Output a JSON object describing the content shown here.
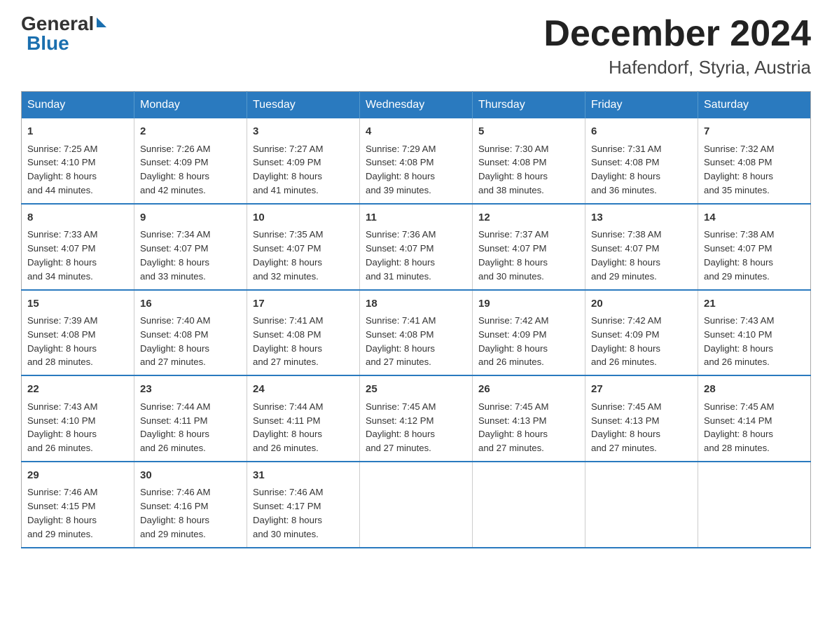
{
  "logo": {
    "general": "General",
    "blue": "Blue"
  },
  "title": "December 2024",
  "location": "Hafendorf, Styria, Austria",
  "days_of_week": [
    "Sunday",
    "Monday",
    "Tuesday",
    "Wednesday",
    "Thursday",
    "Friday",
    "Saturday"
  ],
  "weeks": [
    [
      {
        "day": "1",
        "sunrise": "7:25 AM",
        "sunset": "4:10 PM",
        "daylight": "8 hours and 44 minutes."
      },
      {
        "day": "2",
        "sunrise": "7:26 AM",
        "sunset": "4:09 PM",
        "daylight": "8 hours and 42 minutes."
      },
      {
        "day": "3",
        "sunrise": "7:27 AM",
        "sunset": "4:09 PM",
        "daylight": "8 hours and 41 minutes."
      },
      {
        "day": "4",
        "sunrise": "7:29 AM",
        "sunset": "4:08 PM",
        "daylight": "8 hours and 39 minutes."
      },
      {
        "day": "5",
        "sunrise": "7:30 AM",
        "sunset": "4:08 PM",
        "daylight": "8 hours and 38 minutes."
      },
      {
        "day": "6",
        "sunrise": "7:31 AM",
        "sunset": "4:08 PM",
        "daylight": "8 hours and 36 minutes."
      },
      {
        "day": "7",
        "sunrise": "7:32 AM",
        "sunset": "4:08 PM",
        "daylight": "8 hours and 35 minutes."
      }
    ],
    [
      {
        "day": "8",
        "sunrise": "7:33 AM",
        "sunset": "4:07 PM",
        "daylight": "8 hours and 34 minutes."
      },
      {
        "day": "9",
        "sunrise": "7:34 AM",
        "sunset": "4:07 PM",
        "daylight": "8 hours and 33 minutes."
      },
      {
        "day": "10",
        "sunrise": "7:35 AM",
        "sunset": "4:07 PM",
        "daylight": "8 hours and 32 minutes."
      },
      {
        "day": "11",
        "sunrise": "7:36 AM",
        "sunset": "4:07 PM",
        "daylight": "8 hours and 31 minutes."
      },
      {
        "day": "12",
        "sunrise": "7:37 AM",
        "sunset": "4:07 PM",
        "daylight": "8 hours and 30 minutes."
      },
      {
        "day": "13",
        "sunrise": "7:38 AM",
        "sunset": "4:07 PM",
        "daylight": "8 hours and 29 minutes."
      },
      {
        "day": "14",
        "sunrise": "7:38 AM",
        "sunset": "4:07 PM",
        "daylight": "8 hours and 29 minutes."
      }
    ],
    [
      {
        "day": "15",
        "sunrise": "7:39 AM",
        "sunset": "4:08 PM",
        "daylight": "8 hours and 28 minutes."
      },
      {
        "day": "16",
        "sunrise": "7:40 AM",
        "sunset": "4:08 PM",
        "daylight": "8 hours and 27 minutes."
      },
      {
        "day": "17",
        "sunrise": "7:41 AM",
        "sunset": "4:08 PM",
        "daylight": "8 hours and 27 minutes."
      },
      {
        "day": "18",
        "sunrise": "7:41 AM",
        "sunset": "4:08 PM",
        "daylight": "8 hours and 27 minutes."
      },
      {
        "day": "19",
        "sunrise": "7:42 AM",
        "sunset": "4:09 PM",
        "daylight": "8 hours and 26 minutes."
      },
      {
        "day": "20",
        "sunrise": "7:42 AM",
        "sunset": "4:09 PM",
        "daylight": "8 hours and 26 minutes."
      },
      {
        "day": "21",
        "sunrise": "7:43 AM",
        "sunset": "4:10 PM",
        "daylight": "8 hours and 26 minutes."
      }
    ],
    [
      {
        "day": "22",
        "sunrise": "7:43 AM",
        "sunset": "4:10 PM",
        "daylight": "8 hours and 26 minutes."
      },
      {
        "day": "23",
        "sunrise": "7:44 AM",
        "sunset": "4:11 PM",
        "daylight": "8 hours and 26 minutes."
      },
      {
        "day": "24",
        "sunrise": "7:44 AM",
        "sunset": "4:11 PM",
        "daylight": "8 hours and 26 minutes."
      },
      {
        "day": "25",
        "sunrise": "7:45 AM",
        "sunset": "4:12 PM",
        "daylight": "8 hours and 27 minutes."
      },
      {
        "day": "26",
        "sunrise": "7:45 AM",
        "sunset": "4:13 PM",
        "daylight": "8 hours and 27 minutes."
      },
      {
        "day": "27",
        "sunrise": "7:45 AM",
        "sunset": "4:13 PM",
        "daylight": "8 hours and 27 minutes."
      },
      {
        "day": "28",
        "sunrise": "7:45 AM",
        "sunset": "4:14 PM",
        "daylight": "8 hours and 28 minutes."
      }
    ],
    [
      {
        "day": "29",
        "sunrise": "7:46 AM",
        "sunset": "4:15 PM",
        "daylight": "8 hours and 29 minutes."
      },
      {
        "day": "30",
        "sunrise": "7:46 AM",
        "sunset": "4:16 PM",
        "daylight": "8 hours and 29 minutes."
      },
      {
        "day": "31",
        "sunrise": "7:46 AM",
        "sunset": "4:17 PM",
        "daylight": "8 hours and 30 minutes."
      },
      null,
      null,
      null,
      null
    ]
  ],
  "labels": {
    "sunrise": "Sunrise:",
    "sunset": "Sunset:",
    "daylight": "Daylight:"
  }
}
